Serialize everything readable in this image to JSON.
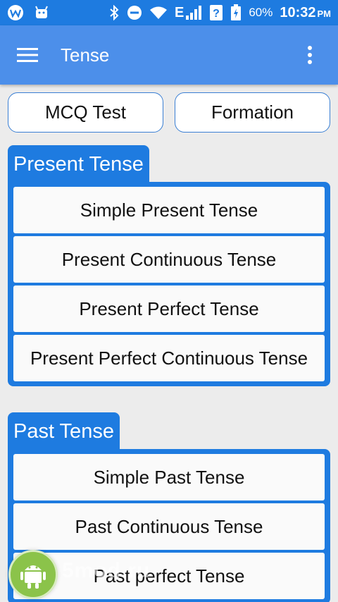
{
  "status_bar": {
    "battery": "60%",
    "time": "10:32",
    "ampm": "PM",
    "network": "E"
  },
  "app_bar": {
    "title": "Tense"
  },
  "top_buttons": {
    "mcq": "MCQ Test",
    "formation": "Formation"
  },
  "sections": {
    "present": {
      "title": "Present Tense",
      "items": [
        "Simple Present Tense",
        "Present Continuous Tense",
        "Present Perfect Tense",
        "Present Perfect Continuous Tense"
      ]
    },
    "past": {
      "title": "Past Tense",
      "items": [
        "Simple Past Tense",
        "Past Continuous Tense",
        "Past perfect Tense"
      ]
    }
  },
  "watermark": {
    "text": "5mod.ru"
  },
  "colors": {
    "status_bar": "#1E7BE0",
    "app_bar": "#4C8FEA",
    "section": "#1E7BE0",
    "background": "#ECECEC"
  }
}
